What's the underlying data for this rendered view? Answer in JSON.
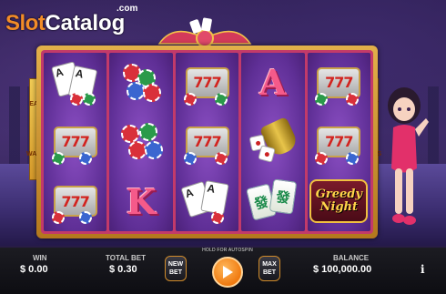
{
  "logo": {
    "slot": "Slot",
    "catalog": "Catalog",
    "com": ".com"
  },
  "side_banner": {
    "top": "EAT",
    "bottom": "WAYS"
  },
  "reels": [
    [
      "cards",
      "777",
      "777"
    ],
    [
      "chips",
      "chips",
      "letter-K"
    ],
    [
      "777",
      "777",
      "cards"
    ],
    [
      "letter-A",
      "dice-cup",
      "mahjong"
    ],
    [
      "777",
      "777",
      "greedy-night"
    ]
  ],
  "letters": {
    "A": "A",
    "K": "K"
  },
  "tiles": {
    "left": "發",
    "right": "發"
  },
  "greedy_night": {
    "line1": "Greedy",
    "line2": "Night"
  },
  "bottom_bar": {
    "win_label": "WIN",
    "win_value": "$ 0.00",
    "total_bet_label": "TOTAL BET",
    "total_bet_value": "$ 0.30",
    "new_bet": "NEW BET",
    "spin_hint": "HOLD FOR AUTOSPIN",
    "max_bet": "MAX BET",
    "balance_label": "BALANCE",
    "balance_value": "$ 100,000.00",
    "info": "i"
  },
  "colors": {
    "accent": "#f07a10",
    "frame": "#e2b04a",
    "reel_bg": "#5f2f96",
    "letter": "#f55a8a"
  }
}
